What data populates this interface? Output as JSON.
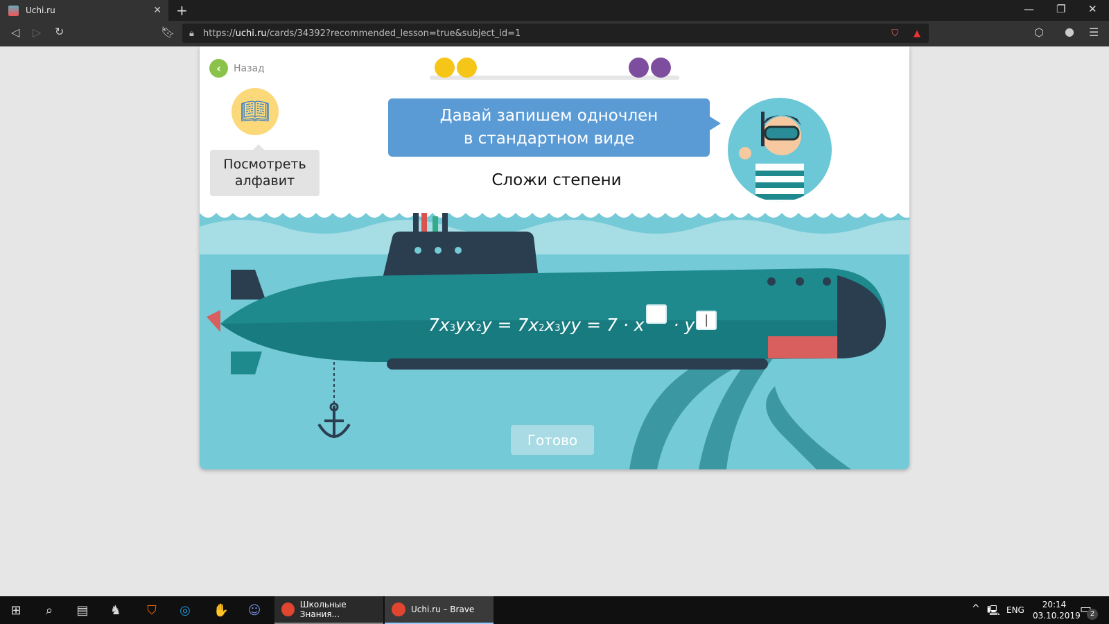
{
  "browser": {
    "tab_title": "Uchi.ru",
    "url_prefix": "https://",
    "url_domain": "uchi.ru",
    "url_path": "/cards/34392?recommended_lesson=true&subject_id=1"
  },
  "page": {
    "back_label": "Назад",
    "progress": {
      "completed": 2,
      "remaining": 2,
      "colors": {
        "done": "#f5c518",
        "todo": "#7e4e9e"
      }
    },
    "alphabet_label_1": "Посмотреть",
    "alphabet_label_2": "алфавит",
    "bubble_line_1": "Давай запишем одночлен",
    "bubble_line_2": "в стандартном виде",
    "subtitle": "Сложи степени",
    "formula": {
      "c1": "7",
      "x": "x",
      "y": "y",
      "e3": "3",
      "e2": "2",
      "eq": "=",
      "dot": "·",
      "c2": "7",
      "c3": "7",
      "cursor": "|"
    },
    "done_label": "Готово"
  },
  "taskbar": {
    "windows": [
      {
        "label": "Школьные Знания..."
      },
      {
        "label": "Uchi.ru – Brave"
      }
    ],
    "lang": "ENG",
    "time": "20:14",
    "date": "03.10.2019",
    "notifications": "2"
  }
}
